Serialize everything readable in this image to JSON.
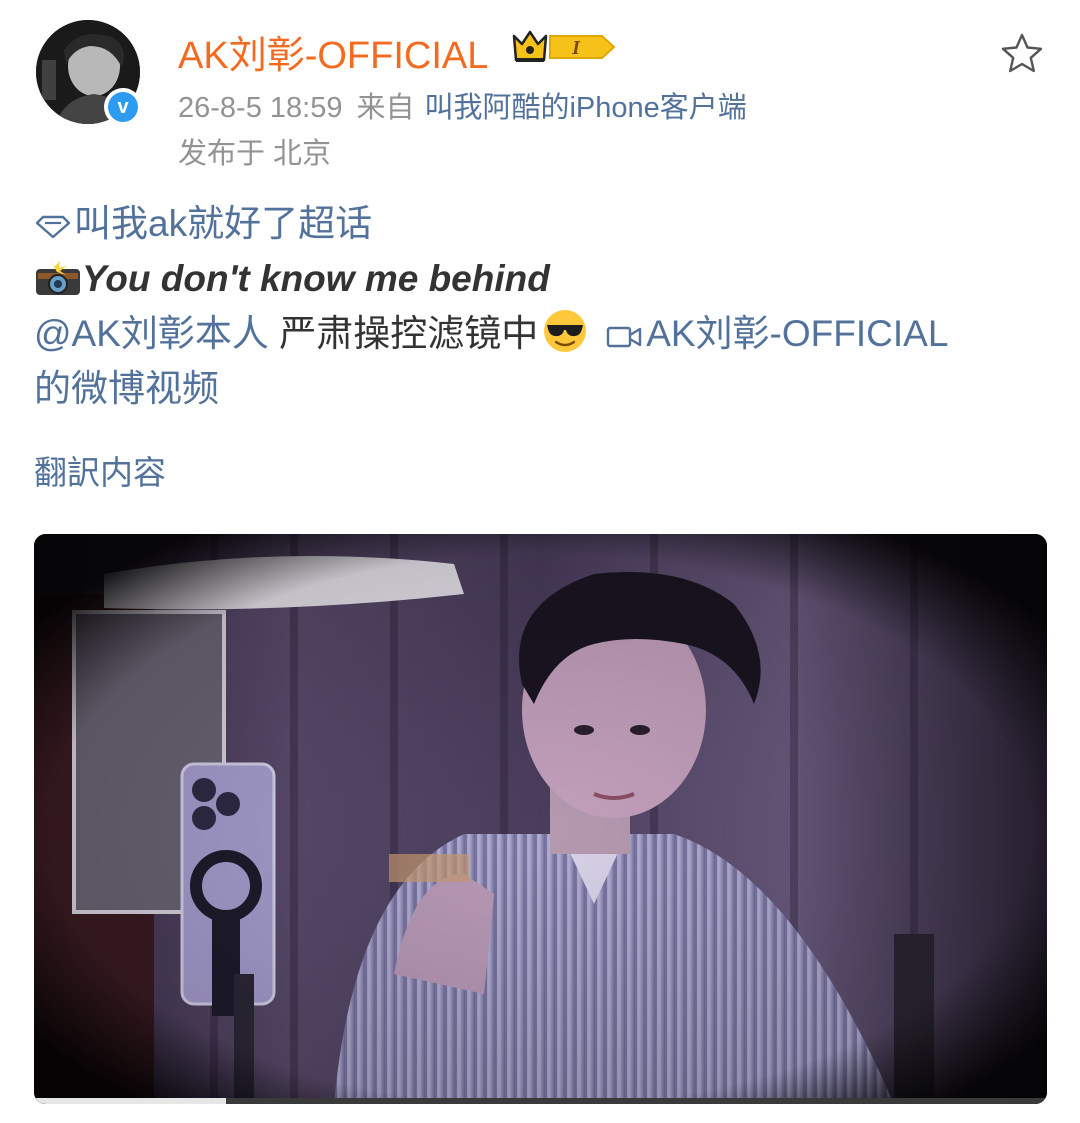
{
  "post": {
    "author": "AK刘彰-OFFICIAL",
    "timestamp": "26-8-5 18:59",
    "source_prefix": "来自",
    "source_client": "叫我阿酷的iPhone客户端",
    "location_label": "发布于 北京",
    "badge_text": "I"
  },
  "body": {
    "supertopic": "叫我ak就好了超话",
    "title": "You don't know me behind",
    "mention": "@AK刘彰本人",
    "text_after_mention": " 严肃操控滤镜中",
    "video_link_part1": "AK刘彰-OFFICIAL",
    "video_link_part2": "的微博视频"
  },
  "translate_label": "翻訳内容",
  "video": {
    "progress": 0.19
  },
  "icons": {
    "favorite": "star-outline-icon",
    "verified": "verified-v-icon",
    "supertopic": "diamond-icon",
    "camera": "camera-flash-emoji",
    "cool": "sunglasses-emoji",
    "video": "video-camera-icon"
  },
  "colors": {
    "username": "#f26b21",
    "link": "#53729b",
    "meta": "#939393",
    "text": "#333333",
    "verified": "#2d9bf0"
  }
}
